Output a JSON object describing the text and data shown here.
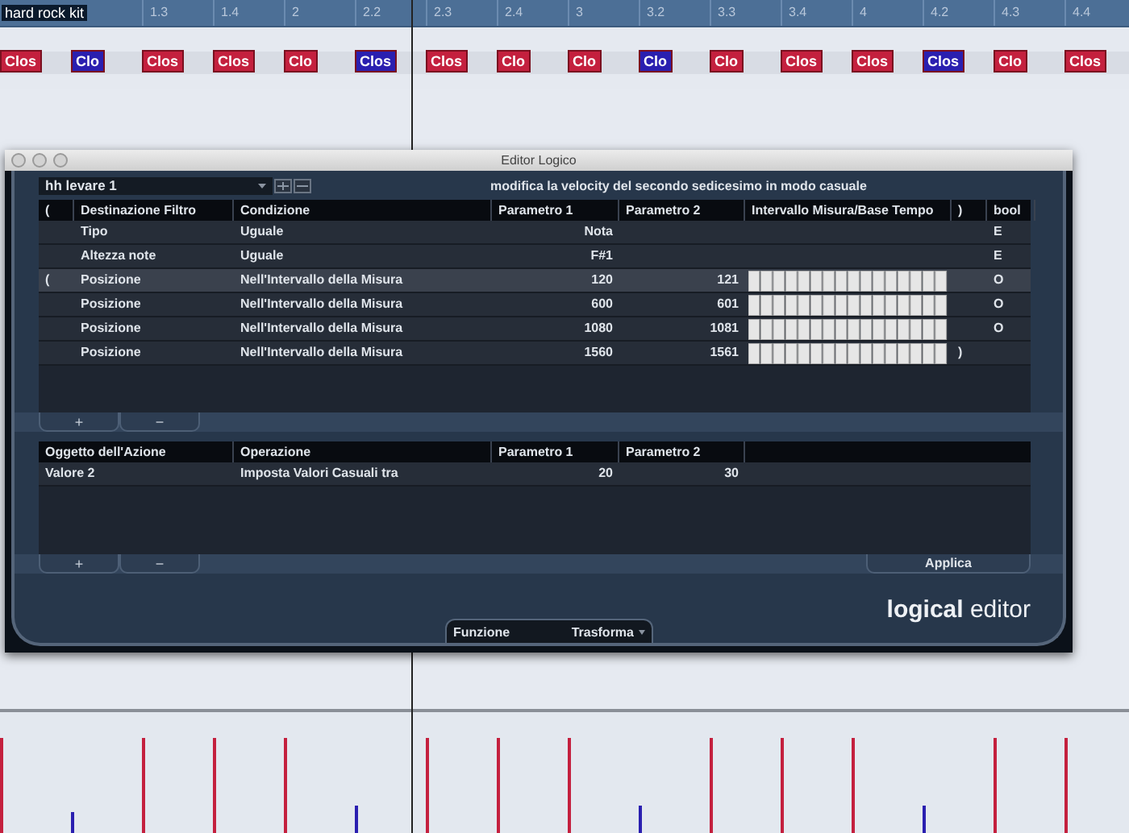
{
  "track": {
    "name": "hard rock kit"
  },
  "ruler": [
    "1.3",
    "1.4",
    "2",
    "2.2",
    "2.3",
    "2.4",
    "3",
    "3.2",
    "3.3",
    "3.4",
    "4",
    "4.2",
    "4.3",
    "4.4"
  ],
  "events": [
    {
      "label": "Clos",
      "color": "#c4203e",
      "accent": true
    },
    {
      "label": "Clo",
      "color": "#2a1fb0",
      "accent": false
    },
    {
      "label": "Clos",
      "color": "#c4203e",
      "accent": true
    },
    {
      "label": "Clos",
      "color": "#c4203e",
      "accent": true
    },
    {
      "label": "Clo",
      "color": "#c4203e",
      "accent": true
    },
    {
      "label": "Clos",
      "color": "#2a1fb0",
      "accent": false
    },
    {
      "label": "Clos",
      "color": "#c4203e",
      "accent": true
    },
    {
      "label": "Clo",
      "color": "#c4203e",
      "accent": true
    },
    {
      "label": "Clo",
      "color": "#c4203e",
      "accent": true
    },
    {
      "label": "Clo",
      "color": "#2a1fb0",
      "accent": false
    },
    {
      "label": "Clo",
      "color": "#c4203e",
      "accent": true
    },
    {
      "label": "Clos",
      "color": "#c4203e",
      "accent": true
    },
    {
      "label": "Clos",
      "color": "#c4203e",
      "accent": true
    },
    {
      "label": "Clos",
      "color": "#2a1fb0",
      "accent": false
    },
    {
      "label": "Clo",
      "color": "#c4203e",
      "accent": true
    },
    {
      "label": "Clos",
      "color": "#c4203e",
      "accent": true
    }
  ],
  "window": {
    "title": "Editor Logico",
    "preset": "hh levare 1",
    "description": "modifica la velocity  del secondo sedicesimo in modo casuale",
    "filter_table": {
      "columns": [
        "(",
        "Destinazione Filtro",
        "Condizione",
        "Parametro 1",
        "Parametro 2",
        "Intervallo Misura/Base Tempo",
        ")",
        "bool"
      ],
      "rows": [
        {
          "target": "Tipo",
          "condition": "Uguale",
          "param1": "Nota",
          "range_grid": false,
          "bool": "E",
          "selected": false
        },
        {
          "target": "Altezza note",
          "condition": "Uguale",
          "param1": "F#1",
          "range_grid": false,
          "bool": "E",
          "selected": false
        },
        {
          "open_paren": "(",
          "target": "Posizione",
          "condition": "Nell'Intervallo della Misura",
          "param1": "120",
          "param2": "121",
          "range_grid": true,
          "bool": "O",
          "selected": true
        },
        {
          "target": "Posizione",
          "condition": "Nell'Intervallo della Misura",
          "param1": "600",
          "param2": "601",
          "range_grid": true,
          "bool": "O",
          "selected": false
        },
        {
          "target": "Posizione",
          "condition": "Nell'Intervallo della Misura",
          "param1": "1080",
          "param2": "1081",
          "range_grid": true,
          "bool": "O",
          "selected": false
        },
        {
          "target": "Posizione",
          "condition": "Nell'Intervallo della Misura",
          "param1": "1560",
          "param2": "1561",
          "range_grid": true,
          "close_paren": ")",
          "selected": false
        }
      ],
      "buttons": [
        "+",
        "−"
      ]
    },
    "action_table": {
      "columns": [
        "Oggetto dell'Azione",
        "Operazione",
        "Parametro 1",
        "Parametro 2"
      ],
      "rows": [
        {
          "object": "Valore 2",
          "operation": "Imposta Valori Casuali tra",
          "param1": "20",
          "param2": "30"
        }
      ],
      "buttons": [
        "+",
        "−"
      ]
    },
    "apply_button": "Applica",
    "function": {
      "label": "Funzione",
      "value": "Trasforma"
    },
    "brand": "**logical** editor"
  }
}
